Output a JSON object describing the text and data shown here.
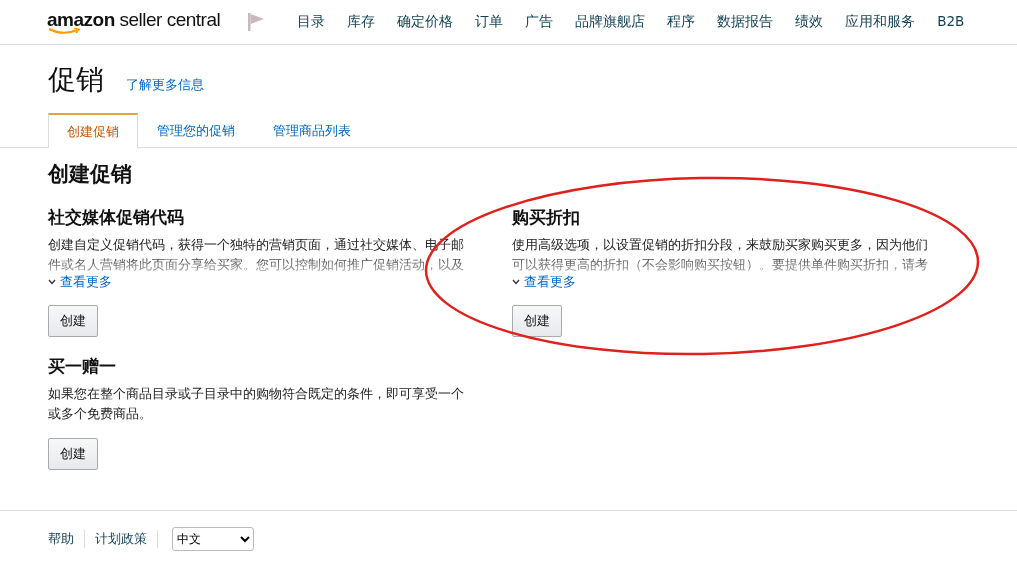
{
  "logo": {
    "brand": "amazon",
    "product": "seller central"
  },
  "nav": [
    "目录",
    "库存",
    "确定价格",
    "订单",
    "广告",
    "品牌旗舰店",
    "程序",
    "数据报告",
    "绩效",
    "应用和服务",
    "B2B"
  ],
  "page": {
    "title": "促销",
    "learn_more": "了解更多信息"
  },
  "tabs": [
    {
      "label": "创建促销",
      "selected": true
    },
    {
      "label": "管理您的促销",
      "selected": false
    },
    {
      "label": "管理商品列表",
      "selected": false
    }
  ],
  "section_title": "创建促销",
  "promotions": [
    {
      "title": "社交媒体促销代码",
      "description": "创建自定义促销代码，获得一个独特的营销页面，通过社交媒体、电子邮件或名人营销将此页面分享给买家。您可以控制如何推广促销活动，以及",
      "faded": true,
      "see_more": "查看更多",
      "button": "创建"
    },
    {
      "title": "购买折扣",
      "description": "使用高级选项，以设置促销的折扣分段，来鼓励买家购买更多，因为他们可以获得更高的折扣（不会影响购买按钮）。要提供单件购买折扣，请考",
      "faded": true,
      "see_more": "查看更多",
      "button": "创建",
      "circled": true
    },
    {
      "title": "买一赠一",
      "description": "如果您在整个商品目录或子目录中的购物符合既定的条件，即可享受一个或多个免费商品。",
      "faded": false,
      "button": "创建"
    }
  ],
  "footer": {
    "links": [
      "帮助",
      "计划政策"
    ],
    "language": "中文"
  }
}
